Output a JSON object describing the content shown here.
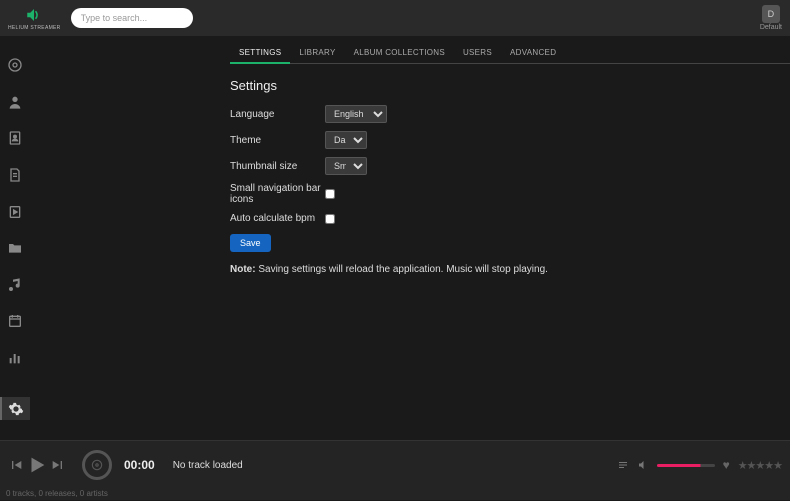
{
  "header": {
    "brand_top": "HELIUM",
    "brand_bottom": "STREAMER",
    "search_placeholder": "Type to search...",
    "user_initial": "D",
    "user_name": "Default"
  },
  "tabs": {
    "settings": "SETTINGS",
    "library": "LIBRARY",
    "album_collections": "ALBUM COLLECTIONS",
    "users": "USERS",
    "advanced": "ADVANCED"
  },
  "page": {
    "title": "Settings",
    "language_label": "Language",
    "language_value": "English",
    "theme_label": "Theme",
    "theme_value": "Dark",
    "thumb_label": "Thumbnail size",
    "thumb_value": "Small",
    "small_nav_label": "Small navigation bar icons",
    "auto_bpm_label": "Auto calculate bpm",
    "save_label": "Save",
    "note_prefix": "Note:",
    "note_text": " Saving settings will reload the application. Music will stop playing."
  },
  "player": {
    "time": "00:00",
    "track_status": "No track loaded",
    "footer": "0 tracks, 0 releases, 0 artists"
  }
}
